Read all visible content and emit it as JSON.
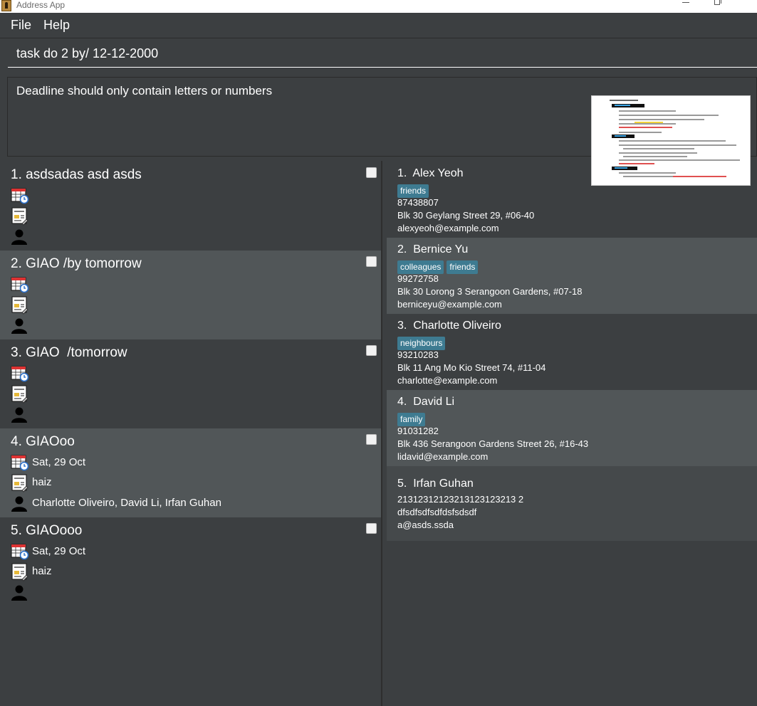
{
  "window": {
    "title": "Address App"
  },
  "menu": {
    "file": "File",
    "help": "Help"
  },
  "command": {
    "value": "task do 2 by/ 12-12-2000"
  },
  "result": {
    "message": "Deadline should only contain letters or numbers"
  },
  "tasks": [
    {
      "title": "1. asdsadas asd asds",
      "deadline": "",
      "note": "",
      "people": ""
    },
    {
      "title": "2. GIAO /by tomorrow",
      "deadline": "",
      "note": "",
      "people": ""
    },
    {
      "title": "3. GIAO  /tomorrow",
      "deadline": "",
      "note": "",
      "people": ""
    },
    {
      "title": "4. GIAOoo",
      "deadline": "Sat, 29 Oct",
      "note": "haiz",
      "people": "Charlotte Oliveiro, David Li, Irfan Guhan"
    },
    {
      "title": "5. GIAOooo",
      "deadline": "Sat, 29 Oct",
      "note": "haiz",
      "people": ""
    }
  ],
  "persons": [
    {
      "name": "1.  Alex Yeoh",
      "tags": [
        "friends"
      ],
      "phone": "87438807",
      "address": "Blk 30 Geylang Street 29, #06-40",
      "email": "alexyeoh@example.com"
    },
    {
      "name": "2.  Bernice Yu",
      "tags": [
        "colleagues",
        "friends"
      ],
      "phone": "99272758",
      "address": "Blk 30 Lorong 3 Serangoon Gardens, #07-18",
      "email": "berniceyu@example.com"
    },
    {
      "name": "3.  Charlotte Oliveiro",
      "tags": [
        "neighbours"
      ],
      "phone": "93210283",
      "address": "Blk 11 Ang Mo Kio Street 74, #11-04",
      "email": "charlotte@example.com"
    },
    {
      "name": "4.  David Li",
      "tags": [
        "family"
      ],
      "phone": "91031282",
      "address": "Blk 436 Serangoon Gardens Street 26, #16-43",
      "email": "lidavid@example.com"
    },
    {
      "name": "5.  Irfan Guhan",
      "tags": [],
      "phone": "21312312123213123123213 2",
      "address": "dfsdfsdfsdfdsfsdsdf",
      "email": "a@asds.ssda"
    }
  ],
  "colors": {
    "background": "#3c3f41",
    "card_alt": "#515658",
    "tag": "#3e7b91"
  }
}
